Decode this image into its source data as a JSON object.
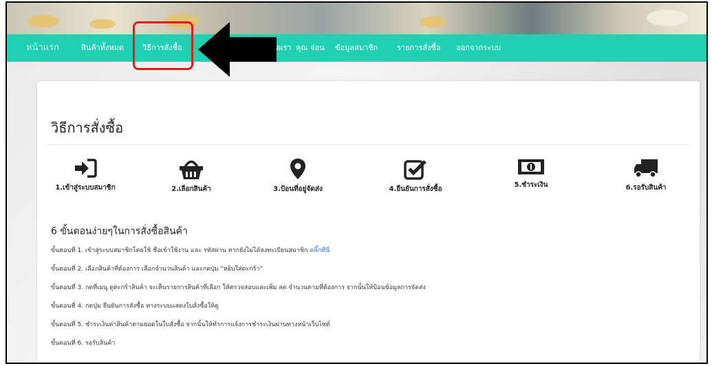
{
  "nav": {
    "brand": "หน้าแรก",
    "items": [
      "สินค้าทั้งหมด",
      "วิธีการสั่งซื้อ",
      "ต่อเรา",
      "คุณ จ่อน",
      "ข้อมูลสมาชิก",
      "รายการสั่งซื้อ",
      "ออกจากระบบ"
    ]
  },
  "page": {
    "title": "วิธีการสั่งซื้อ",
    "steps": [
      {
        "label": "1.เข้าสู่ระบบสมาชิก",
        "icon": "sign-in-icon"
      },
      {
        "label": "2.เลือกสินค้า",
        "icon": "basket-icon"
      },
      {
        "label": "3.ป้อนที่อยู่จัดส่ง",
        "icon": "map-marker-icon"
      },
      {
        "label": "4.ยืนยันการสั่งซื้อ",
        "icon": "check-square-icon"
      },
      {
        "label": "5.ชำระเงิน",
        "icon": "money-icon"
      },
      {
        "label": "6.รอรับสินค้า",
        "icon": "truck-icon"
      }
    ],
    "subtitle": "6 ขั้นตอนง่ายๆในการสั่งซื้อสินค้า",
    "instructions": [
      "ขั้นตอนที่ 1. เข้าสู่ระบบสมาชิกโดยใช้ ชื่อเข้าใช้งาน และ รหัสผ่าน หากยังไม่ได้ลงทะเบียนสมาชิก",
      "ขั้นตอนที่ 2. เลือกสินค้าที่ต้องการ เลือกจำนวนสินค้า และกดปุ่ม \"หยิบใส่ตะกร้า\"",
      "ขั้นตอนที่ 3. กดที่เมนู ดูตะกร้าสินค้า จะเห็นรายการสินค้าที่เลือก ให้ตรวจสอบและเพิ่ม ลด จำนวนตามที่ต้องการ จากนั้นให้ป้อนข้อมูลการจัดส่ง",
      "ขั้นตอนที่ 4. กดปุ่ม ยืนยันการสั่งซื้อ ทางระบบแสดงใบสั่งซื้อให้ดู",
      "ขั้นตอนที่ 5. ชำระเงินค่าสินค้าตามยอดในใบสั่งซื้อ จากนั้นให้ทำการแจ้งการชำระเงินผ่านทางหน้าเว็บไซต์",
      "ขั้นตอนที่ 6. รอรับสินค้า"
    ],
    "register_link": "คลิ๊กที่นี่"
  }
}
